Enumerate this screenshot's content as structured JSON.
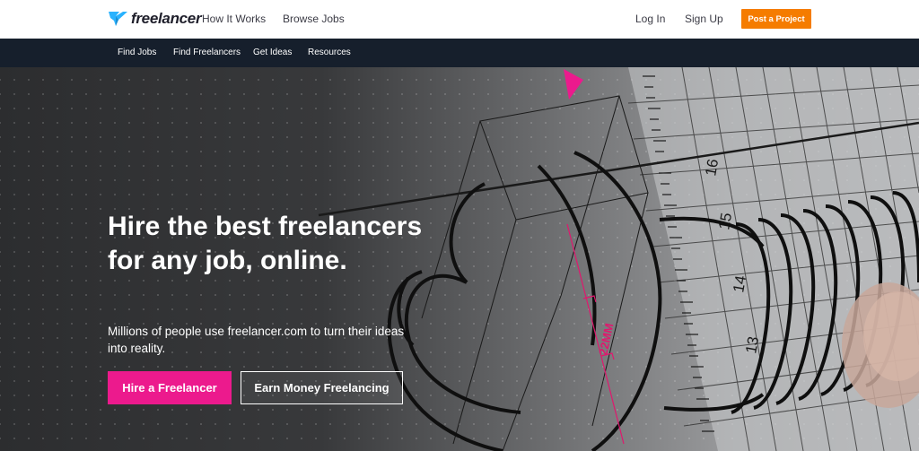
{
  "header": {
    "logo_text": "freelancer",
    "nav": [
      "How It Works",
      "Browse Jobs"
    ],
    "login": "Log In",
    "signup": "Sign Up",
    "post_project": "Post a Project"
  },
  "subnav": [
    "Find Jobs",
    "Find Freelancers",
    "Get Ideas",
    "Resources"
  ],
  "hero": {
    "headline": "Hire the best freelancers for any job, online.",
    "subtext": "Millions of people use freelancer.com to turn their ideas into reality.",
    "hire_button": "Hire a Freelancer",
    "earn_button": "Earn Money Freelancing",
    "drawing_label": "22MM",
    "ruler_numbers": [
      "16",
      "15",
      "14",
      "13"
    ]
  },
  "colors": {
    "accent_orange": "#f57c00",
    "accent_pink": "#ec1a8d",
    "subnav_bg": "#161f2c",
    "logo_blue": "#29b2fe"
  }
}
